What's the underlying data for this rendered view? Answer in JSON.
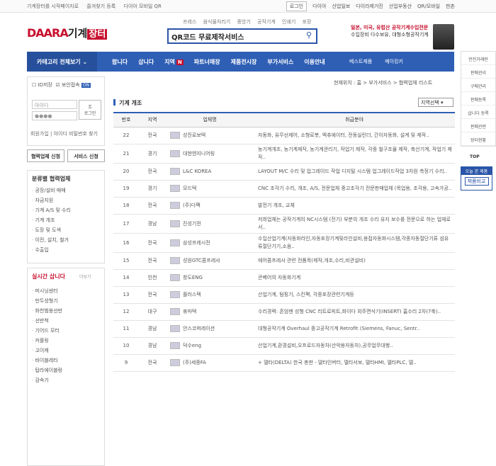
{
  "topbar": {
    "left": [
      "기계장터를 시작페이지로",
      "즐겨찾기 등록",
      "다이아 모바일 QR"
    ],
    "right": [
      "로그인",
      "다이아",
      "산업일보",
      "다이라제거진",
      "산업부동산",
      "QR/모바일",
      "판촌"
    ]
  },
  "subnav": [
    "프레스",
    "음식물처리기",
    "중앙기",
    "공작기계",
    "인쇄기",
    "포장"
  ],
  "logo": {
    "daara": "DAARA",
    "gigye": "기계",
    "jang": "장터"
  },
  "search": {
    "value": "QR코드 무료제작서비스"
  },
  "ad": {
    "line1": "일본, 미국, 유럽산 공작기계수입전문",
    "line2": "수입장비 다수보유, 대형소형공작기계"
  },
  "mainnav": {
    "category": "카테고리 전체보기",
    "items": [
      "팝니다",
      "삽니다",
      "지역",
      "파트너매장",
      "제품전시장",
      "부가서비스",
      "이용안내"
    ],
    "new_badge": "N",
    "right": [
      "베스트제품",
      "메이킹키"
    ]
  },
  "rightbar": [
    "안전거래란",
    "판매관리",
    "구매관리",
    "판매등록",
    "삽니다 등록",
    "판매관련",
    "장터현황"
  ],
  "top_label": "TOP",
  "today": {
    "title": "오늘 본 제품",
    "button": "제품비교"
  },
  "login": {
    "id_save": "ID저장",
    "secure": "보안접속",
    "on": "ON",
    "id_ph": "아이디",
    "pw_ph": "●●●●",
    "btn1": "로그인",
    "links": "회원가입 | 아이디 비밀번호 찾기"
  },
  "link_buttons": [
    "협력업체 신청",
    "서비스 신청"
  ],
  "categories": {
    "title": "분류별 협력업체",
    "items": [
      "공장/설비 매매",
      "자금지원",
      "기계 A/S 및 수리",
      "기계 개조",
      "도장 및 도색",
      "이전, 설치, 철거",
      "수출입"
    ]
  },
  "live": {
    "title": "실시간 삽니다",
    "more": "더보기",
    "items": [
      "머시닝센터",
      "만두성형기",
      "화천범용선반",
      "선반척",
      "기어드 모터",
      "커플링",
      "고이케",
      "바이블레타",
      "탑라에이블랑",
      "감속기"
    ]
  },
  "breadcrumb": "현재위치 : 홈 > 부가서비스 > 협력업체 리스트",
  "section_title": "기계 개조",
  "region_select": "지역선택",
  "table": {
    "headers": [
      "번호",
      "지역",
      "업체명",
      "취급분야"
    ],
    "rows": [
      {
        "no": "22",
        "region": "전국",
        "name": "성진로보텍",
        "desc": "자동화, 유무선제어, 소형로봇, 엑츄에이터, 전동실린더, 간이자동화, 설계 및 제작.."
      },
      {
        "no": "21",
        "region": "경기",
        "name": "대현엔지니어링",
        "desc": "농기계개조, 농기계제작, 농기계관리기, 작업기 제작, 각종 철구조물 제작, 축산기계, 작업기 제작.."
      },
      {
        "no": "20",
        "region": "전국",
        "name": "L&C KOREA",
        "desc": "LAYOUT M/C 수리 및 업그레이드 작업 디지털 시스템 업그레이드작업 3차원 측정기 수리.."
      },
      {
        "no": "19",
        "region": "경기",
        "name": "모드텍",
        "desc": "CNC 조각기 수리, 개조, A/S, 전문업체 중고조각기 전문판매업체 (목업용, 조각용, 고속가공.."
      },
      {
        "no": "18",
        "region": "전국",
        "name": "(주)다팩",
        "desc": "발전기 개조, 교체"
      },
      {
        "no": "17",
        "region": "경남",
        "name": "진성기전",
        "desc": "저희업체는 공작기계의 NC시스템 (전기) 부분의 개조 수리 유지 보수를 전문으로 하는 업체로서.."
      },
      {
        "no": "16",
        "region": "전국",
        "name": "삼성프레시전",
        "desc": "수입산업기계(자동화라인,자동포장기계및라인설비,용접자동화시스템,각종자동절단기류 섬유류절단기기,소음.."
      },
      {
        "no": "15",
        "region": "전국",
        "name": "성원GTC콤프레샤",
        "desc": "에어콤프레샤 관련 전품목(제작,개조,수리,비관설비)"
      },
      {
        "no": "14",
        "region": "인천",
        "name": "창도ENG",
        "desc": "콘베어의 자동화기계"
      },
      {
        "no": "13",
        "region": "전국",
        "name": "플러스텍",
        "desc": "산업기계, 텀핑기, 스킨팩, 각종포장관련기계등"
      },
      {
        "no": "12",
        "region": "대구",
        "name": "휴마텍",
        "desc": "수리경력: 존엄맨 성형 CNC 리트로피트,화이다 외주면삭기(INSERT) 홈수리 2차(7축).."
      },
      {
        "no": "11",
        "region": "경남",
        "name": "안스코퍼레이션",
        "desc": "대형공작기계 Overhaul 중고공작기계 Retrofit (Siemens, Fanuc, Sentr.."
      },
      {
        "no": "10",
        "region": "경남",
        "name": "덕수eng",
        "desc": "산업기계,환경설비,오프로드자동차(산악용자동차),공무업무대행.."
      },
      {
        "no": "9",
        "region": "전국",
        "name": "(주)세중FA",
        "desc": "+ 델타(DELTA) 한국 총판 - 델타인버터, 델타서보, 델타HMI, 델타PLC, 델.."
      }
    ]
  }
}
